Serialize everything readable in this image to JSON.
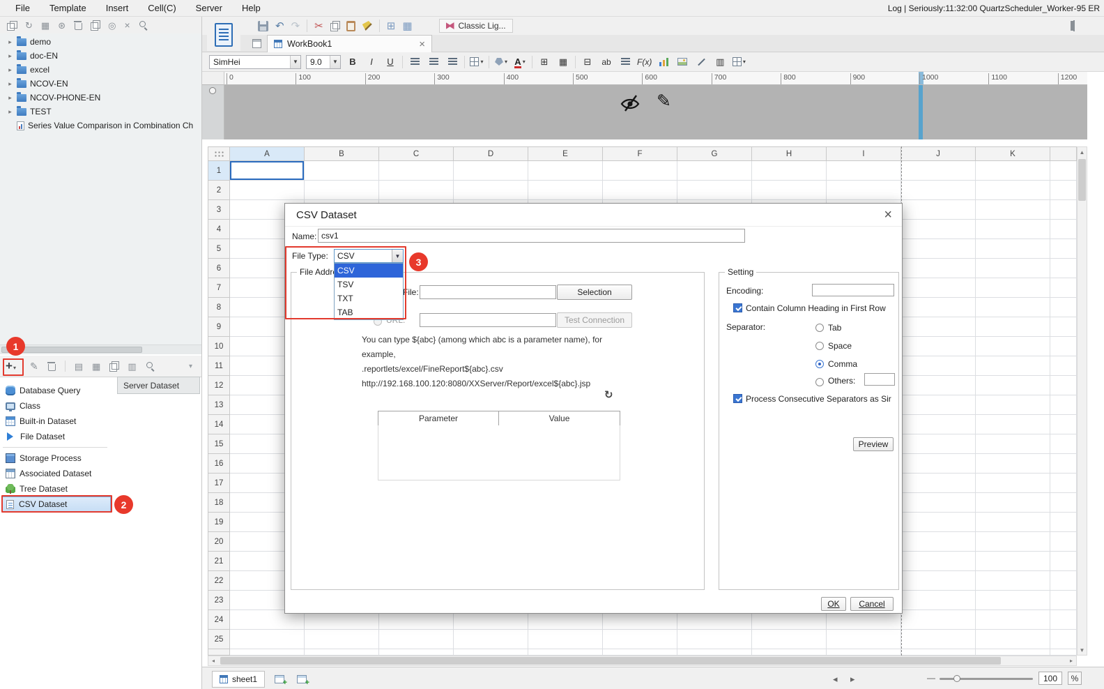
{
  "menubar": {
    "items": [
      "File",
      "Template",
      "Insert",
      "Cell(C)",
      "Server",
      "Help"
    ],
    "status": "Log | Seriously:11:32:00 QuartzScheduler_Worker-95 ER"
  },
  "tree": {
    "folders": [
      "demo",
      "doc-EN",
      "excel",
      "NCOV-EN",
      "NCOV-PHONE-EN",
      "TEST"
    ],
    "file": "Series Value Comparison in Combination Ch"
  },
  "dataset_panel": {
    "tab_label": "Server Dataset",
    "selected_item": "CSV Dataset",
    "items": [
      {
        "label": "Database Query",
        "icon": "database-icon",
        "icon_class": "di-db"
      },
      {
        "label": "Class",
        "icon": "class-icon",
        "icon_class": "di-class"
      },
      {
        "label": "Built-in Dataset",
        "icon": "builtin-dataset-icon",
        "icon_class": "di-builtin"
      },
      {
        "label": "File Dataset",
        "icon": "file-dataset-icon",
        "icon_class": "di-filearrow"
      },
      {
        "label": "Storage Process",
        "icon": "storage-process-icon",
        "icon_class": "di-storage"
      },
      {
        "label": "Associated Dataset",
        "icon": "associated-dataset-icon",
        "icon_class": "di-assoc"
      },
      {
        "label": "Tree Dataset",
        "icon": "tree-dataset-icon",
        "icon_class": "di-tree"
      },
      {
        "label": "CSV Dataset",
        "icon": "csv-dataset-icon",
        "icon_class": "di-csv"
      }
    ]
  },
  "workspace": {
    "theme_name": "Classic Lig...",
    "tab_title": "WorkBook1",
    "toolbar": {
      "font_name": "SimHei",
      "font_size": "9.0",
      "bold_label": "B",
      "italic_label": "I",
      "underline_label": "U",
      "ab_label": "ab",
      "fx_label": "F(x)"
    },
    "ruler_ticks": [
      "0",
      "100",
      "200",
      "300",
      "400",
      "500",
      "600",
      "700",
      "800",
      "900",
      "1000",
      "1100",
      "1200"
    ],
    "columns": [
      "A",
      "B",
      "C",
      "D",
      "E",
      "F",
      "G",
      "H",
      "I",
      "J",
      "K"
    ],
    "row_count": 25,
    "sheet_tab": "sheet1",
    "zoom_value": "100",
    "zoom_unit": "%"
  },
  "dialog": {
    "title": "CSV Dataset",
    "name_label": "Name:",
    "name_value": "csv1",
    "file_type_label": "File Type:",
    "file_type_value": "CSV",
    "file_type_selected": "CSV",
    "file_type_options": [
      "CSV",
      "TSV",
      "TXT",
      "TAB"
    ],
    "file_address_group": "File Address",
    "file_label": "File:",
    "selection_button": "Selection",
    "url_label": "URL:",
    "test_connection_button": "Test Connection",
    "hint_lines": [
      "You can type ${abc} (among which abc is a parameter name), for",
      "example,",
      ".reportlets/excel/FineReport${abc}.csv",
      "http://192.168.100.120:8080/XXServer/Report/excel${abc}.jsp"
    ],
    "param_table": {
      "headers": [
        "Parameter",
        "Value"
      ],
      "rows": []
    },
    "setting_group": "Setting",
    "encoding_label": "Encoding:",
    "encoding_value": "",
    "contain_heading_label": "Contain Column Heading in First Row",
    "contain_heading_checked": true,
    "separator_label": "Separator:",
    "separator_options": [
      "Tab",
      "Space",
      "Comma"
    ],
    "separator_selected": "Comma",
    "others_label": "Others:",
    "others_value": "",
    "process_label": "Process Consecutive Separators as Sir",
    "process_checked": true,
    "preview_button": "Preview",
    "ok_button": "OK",
    "cancel_button": "Cancel"
  },
  "annotations": {
    "step1": "1",
    "step2": "2",
    "step3": "3",
    "highlight_color": "#e23a2e"
  }
}
